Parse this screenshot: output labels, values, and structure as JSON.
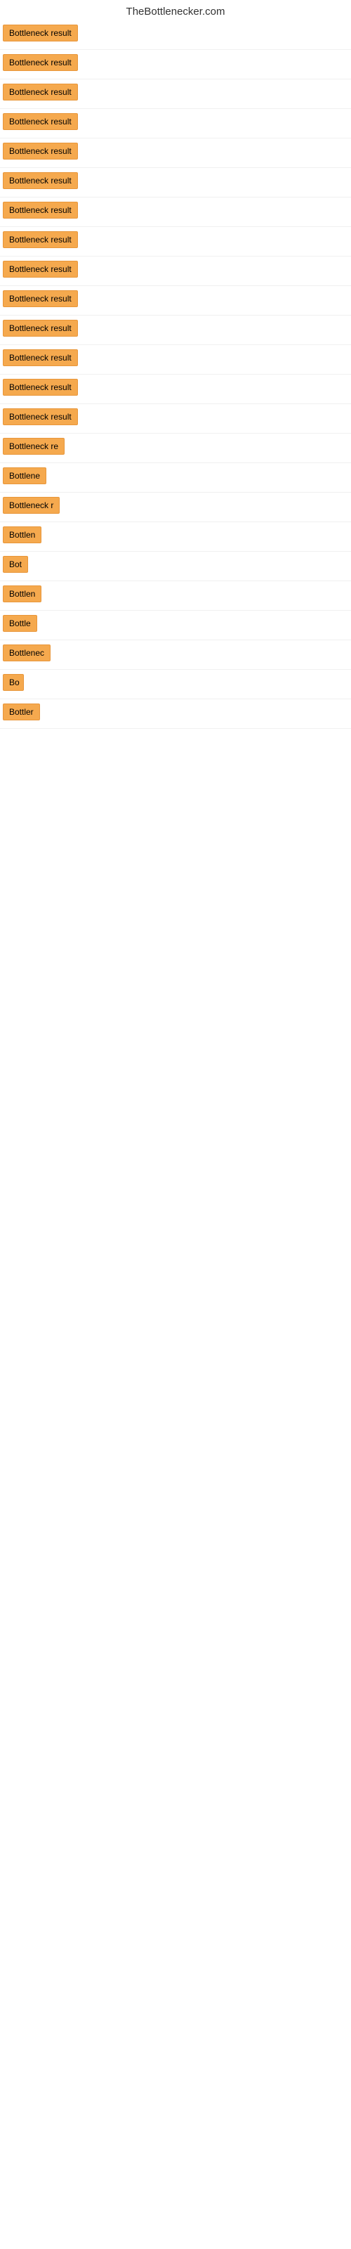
{
  "header": {
    "title": "TheBottlenecker.com"
  },
  "results": [
    {
      "label": "Bottleneck result",
      "width": 130
    },
    {
      "label": "Bottleneck result",
      "width": 130
    },
    {
      "label": "Bottleneck result",
      "width": 130
    },
    {
      "label": "Bottleneck result",
      "width": 130
    },
    {
      "label": "Bottleneck result",
      "width": 130
    },
    {
      "label": "Bottleneck result",
      "width": 130
    },
    {
      "label": "Bottleneck result",
      "width": 130
    },
    {
      "label": "Bottleneck result",
      "width": 130
    },
    {
      "label": "Bottleneck result",
      "width": 130
    },
    {
      "label": "Bottleneck result",
      "width": 130
    },
    {
      "label": "Bottleneck result",
      "width": 130
    },
    {
      "label": "Bottleneck result",
      "width": 130
    },
    {
      "label": "Bottleneck result",
      "width": 130
    },
    {
      "label": "Bottleneck result",
      "width": 130
    },
    {
      "label": "Bottleneck re",
      "width": 100
    },
    {
      "label": "Bottlene",
      "width": 80
    },
    {
      "label": "Bottleneck r",
      "width": 96
    },
    {
      "label": "Bottlen",
      "width": 72
    },
    {
      "label": "Bot",
      "width": 40
    },
    {
      "label": "Bottlen",
      "width": 72
    },
    {
      "label": "Bottle",
      "width": 62
    },
    {
      "label": "Bottlenec",
      "width": 88
    },
    {
      "label": "Bo",
      "width": 30
    },
    {
      "label": "Bottler",
      "width": 65
    }
  ]
}
